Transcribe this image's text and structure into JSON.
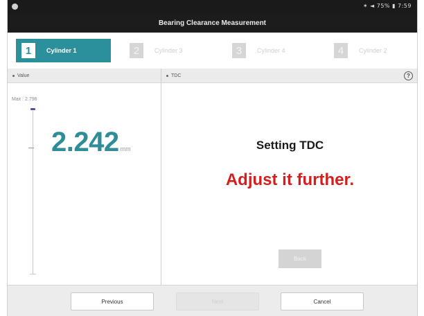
{
  "status_bar": {
    "right_text": "✶ ◄ 75% ▮ 7:59"
  },
  "title": "Bearing Clearance Measurement",
  "tabs": [
    {
      "number": "1",
      "label": "Cylinder 1"
    },
    {
      "number": "2",
      "label": "Cylinder 3"
    },
    {
      "number": "3",
      "label": "Cylinder 4"
    },
    {
      "number": "4",
      "label": "Cylinder 2"
    }
  ],
  "left_pane": {
    "header": "Value",
    "max_text": "Max : 2.796",
    "reading": "2.242",
    "unit": "mm"
  },
  "right_pane": {
    "header": "TDC",
    "help_label": "?",
    "message_title": "Setting TDC",
    "message_warning": "Adjust it further.",
    "back_label": "Back"
  },
  "footer": {
    "previous_label": "Previous",
    "next_label": "Next",
    "cancel_label": "Cancel"
  },
  "colors": {
    "accent": "#2b8f9c",
    "warning": "#d31f1f"
  }
}
